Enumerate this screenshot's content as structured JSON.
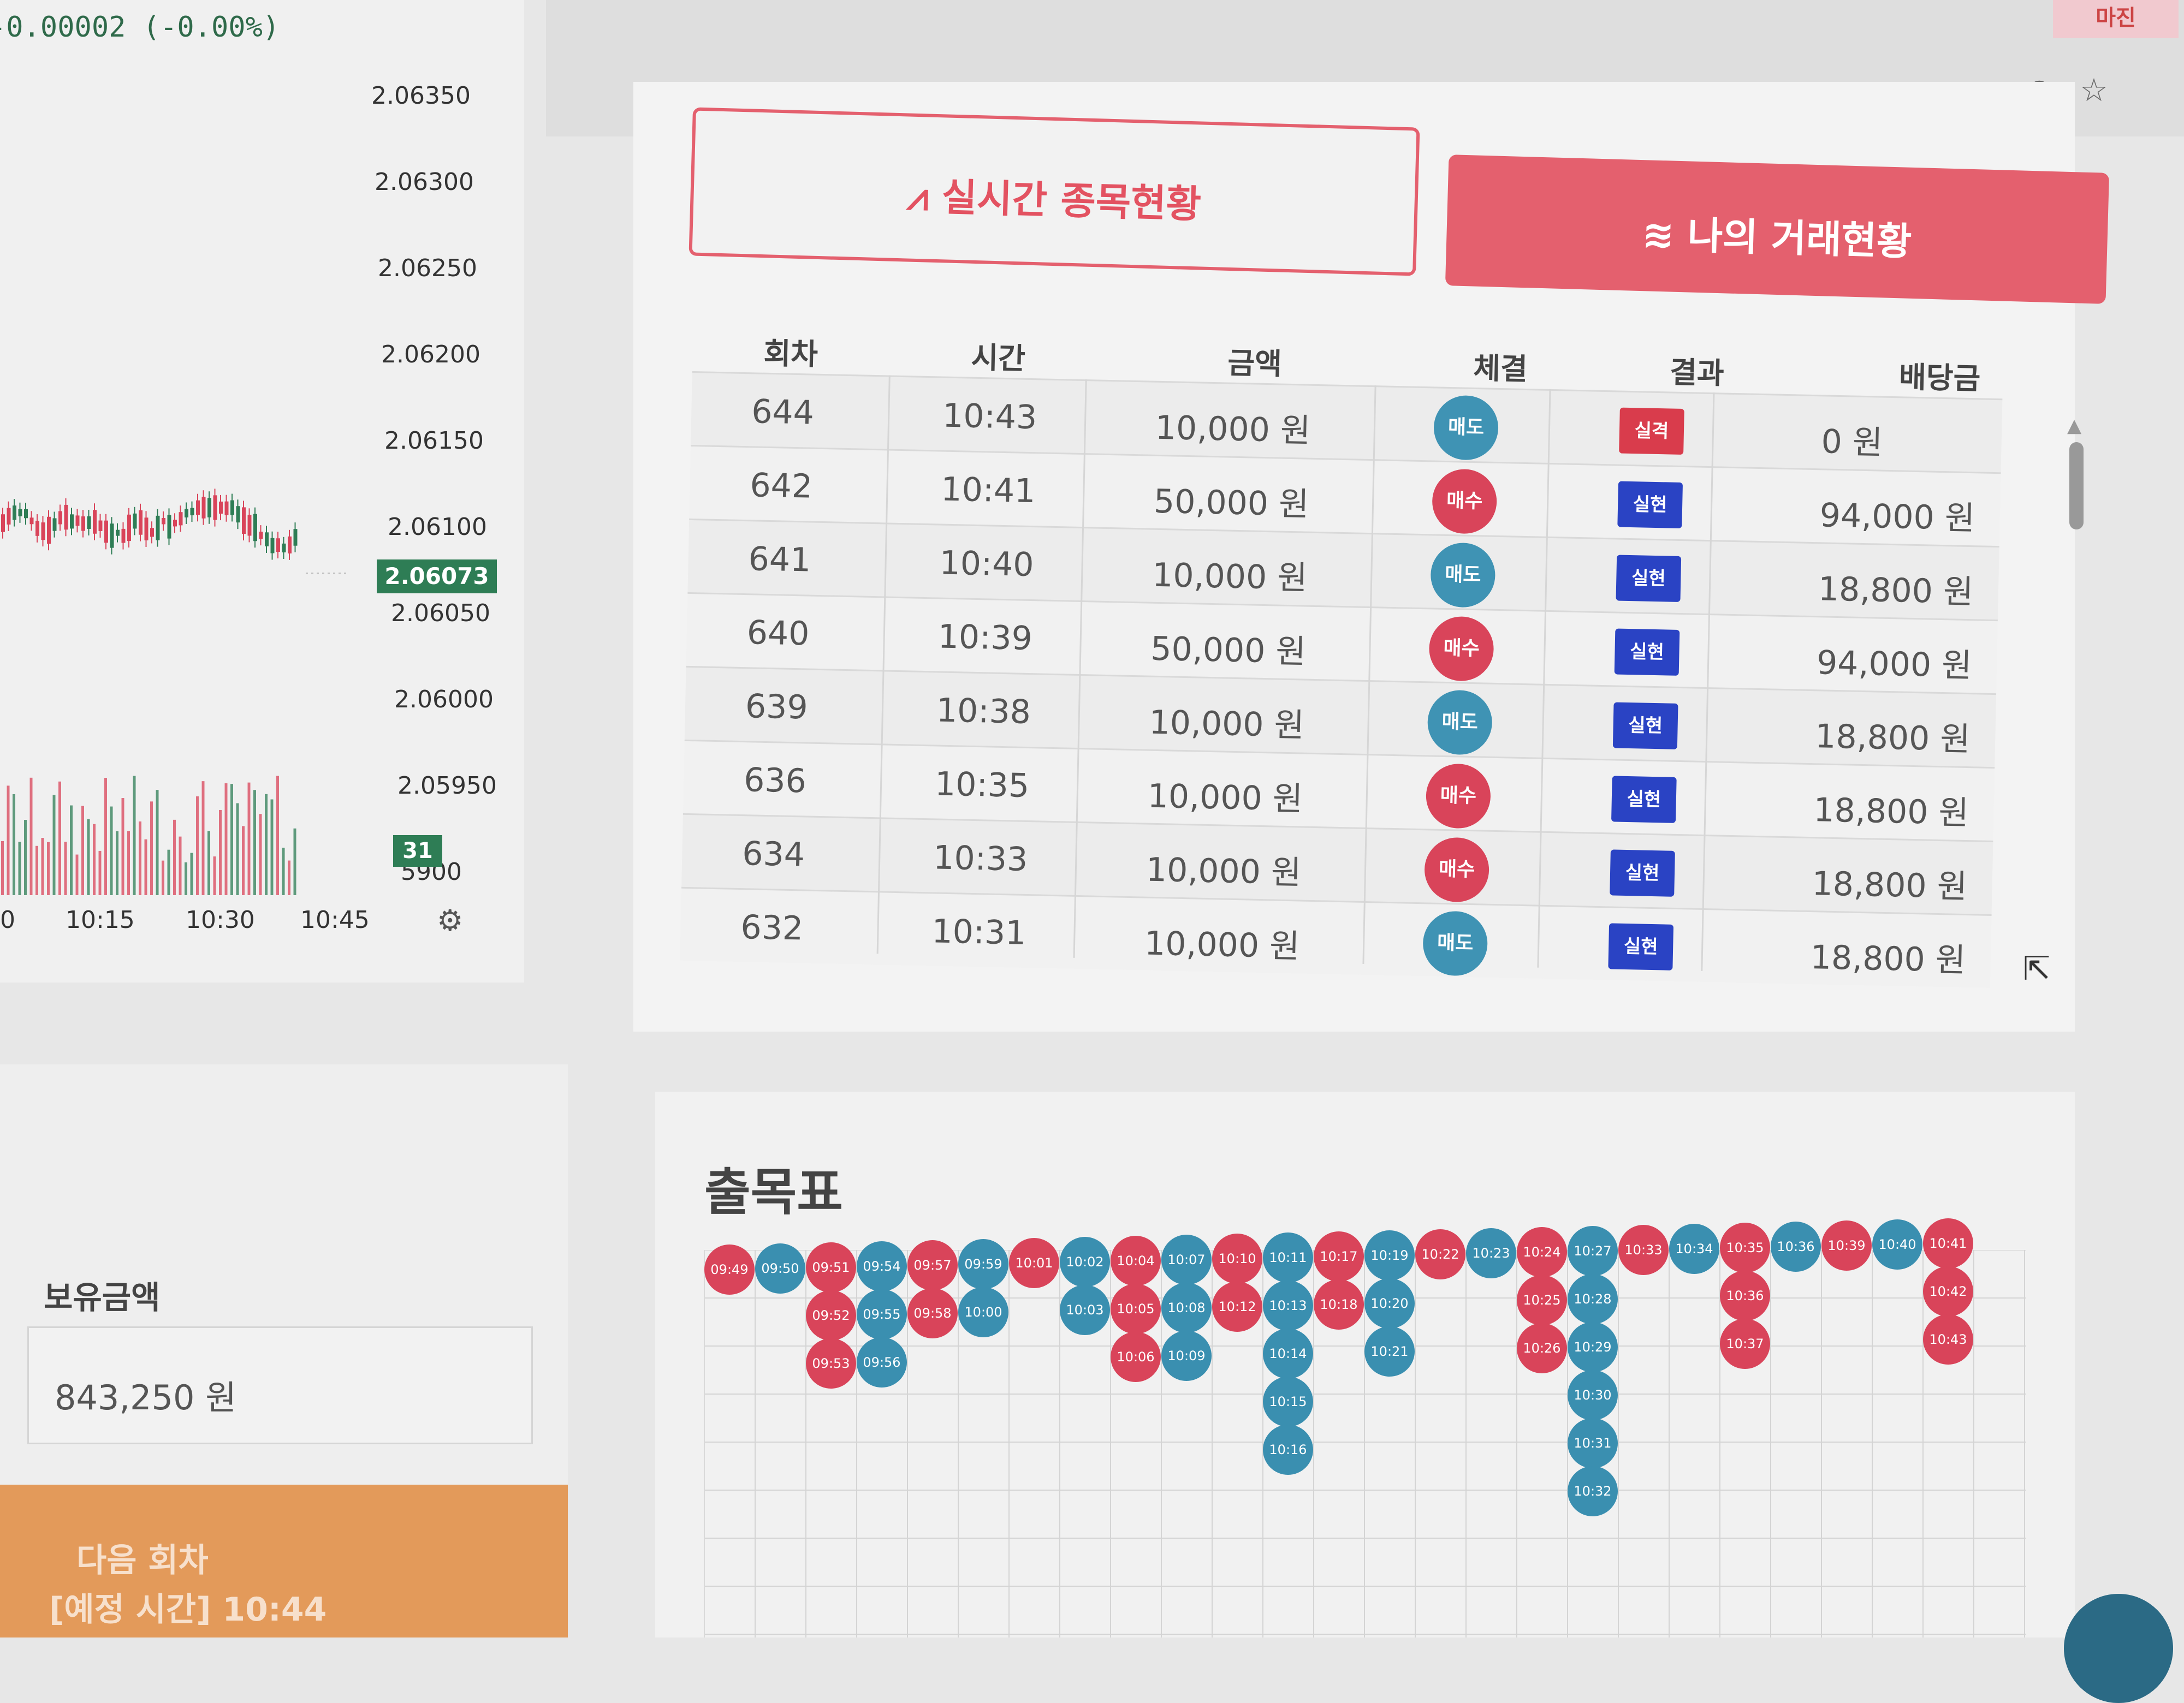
{
  "chart": {
    "change_text": "-0.00002 (-0.00%)",
    "price_ticks": [
      "2.06350",
      "2.06300",
      "2.06250",
      "2.06200",
      "2.06150",
      "2.06100",
      "2.06050",
      "2.06000",
      "2.05950",
      "5900"
    ],
    "current_price": "2.06073",
    "volume_badge": "31",
    "time_ticks": [
      "0",
      "10:15",
      "10:30",
      "10:45"
    ],
    "up_color": "#2e7d55",
    "down_color": "#d9445a"
  },
  "balance": {
    "label": "보유금액",
    "value": "843,250 원"
  },
  "next_round": {
    "label": "다음 회차",
    "time": "[예정 시간] 10:44",
    "color": "#e39a5a"
  },
  "tabs": {
    "live": "실시간 종목현황",
    "mine": "나의 거래현황",
    "accent": "#e4606e"
  },
  "table": {
    "headers": [
      "회차",
      "시간",
      "금액",
      "체결",
      "결과",
      "배당금"
    ],
    "rows": [
      {
        "round": "644",
        "time": "10:43",
        "amount": "10,000 원",
        "side": "매도",
        "side_type": "sell",
        "result": "실격",
        "result_type": "loss",
        "payout": "0 원"
      },
      {
        "round": "642",
        "time": "10:41",
        "amount": "50,000 원",
        "side": "매수",
        "side_type": "buy",
        "result": "실현",
        "result_type": "win",
        "payout": "94,000 원"
      },
      {
        "round": "641",
        "time": "10:40",
        "amount": "10,000 원",
        "side": "매도",
        "side_type": "sell",
        "result": "실현",
        "result_type": "win",
        "payout": "18,800 원"
      },
      {
        "round": "640",
        "time": "10:39",
        "amount": "50,000 원",
        "side": "매수",
        "side_type": "buy",
        "result": "실현",
        "result_type": "win",
        "payout": "94,000 원"
      },
      {
        "round": "639",
        "time": "10:38",
        "amount": "10,000 원",
        "side": "매도",
        "side_type": "sell",
        "result": "실현",
        "result_type": "win",
        "payout": "18,800 원"
      },
      {
        "round": "636",
        "time": "10:35",
        "amount": "10,000 원",
        "side": "매수",
        "side_type": "buy",
        "result": "실현",
        "result_type": "win",
        "payout": "18,800 원"
      },
      {
        "round": "634",
        "time": "10:33",
        "amount": "10,000 원",
        "side": "매수",
        "side_type": "buy",
        "result": "실현",
        "result_type": "win",
        "payout": "18,800 원"
      },
      {
        "round": "632",
        "time": "10:31",
        "amount": "10,000 원",
        "side": "매도",
        "side_type": "sell",
        "result": "실현",
        "result_type": "win",
        "payout": "18,800 원"
      }
    ]
  },
  "bead_road": {
    "title": "출목표",
    "columns": [
      {
        "color": "red",
        "items": [
          "09:49"
        ]
      },
      {
        "color": "blue",
        "items": [
          "09:50"
        ]
      },
      {
        "color": "red",
        "items": [
          "09:51",
          "09:52",
          "09:53"
        ]
      },
      {
        "color": "blue",
        "items": [
          "09:54",
          "09:55",
          "09:56"
        ]
      },
      {
        "color": "red",
        "items": [
          "09:57",
          "09:58"
        ]
      },
      {
        "color": "blue",
        "items": [
          "09:59",
          "10:00"
        ]
      },
      {
        "color": "red",
        "items": [
          "10:01"
        ]
      },
      {
        "color": "blue",
        "items": [
          "10:02",
          "10:03"
        ]
      },
      {
        "color": "red",
        "items": [
          "10:04",
          "10:05",
          "10:06"
        ]
      },
      {
        "color": "blue",
        "items": [
          "10:07",
          "10:08",
          "10:09"
        ]
      },
      {
        "color": "red",
        "items": [
          "10:10",
          "10:12"
        ]
      },
      {
        "color": "blue",
        "items": [
          "10:11",
          "10:13",
          "10:14",
          "10:15",
          "10:16"
        ]
      },
      {
        "color": "red",
        "items": [
          "10:17",
          "10:18"
        ]
      },
      {
        "color": "blue",
        "items": [
          "10:19",
          "10:20",
          "10:21"
        ]
      },
      {
        "color": "red",
        "items": [
          "10:22"
        ]
      },
      {
        "color": "blue",
        "items": [
          "10:23"
        ]
      },
      {
        "color": "red",
        "items": [
          "10:24",
          "10:25",
          "10:26"
        ]
      },
      {
        "color": "blue",
        "items": [
          "10:27",
          "10:28",
          "10:29",
          "10:30",
          "10:31",
          "10:32"
        ]
      },
      {
        "color": "red",
        "items": [
          "10:33"
        ]
      },
      {
        "color": "blue",
        "items": [
          "10:34"
        ]
      },
      {
        "color": "red",
        "items": [
          "10:35",
          "10:36",
          "10:37"
        ]
      },
      {
        "color": "blue",
        "items": [
          "10:36"
        ]
      },
      {
        "color": "red",
        "items": [
          "10:39"
        ]
      },
      {
        "color": "blue",
        "items": [
          "10:40"
        ]
      },
      {
        "color": "red",
        "items": [
          "10:41",
          "10:42",
          "10:43"
        ]
      }
    ]
  },
  "icons": [
    "eye-off-icon",
    "star-icon",
    "settings-icon",
    "pulse-icon",
    "list-icon",
    "cursor-icon"
  ]
}
